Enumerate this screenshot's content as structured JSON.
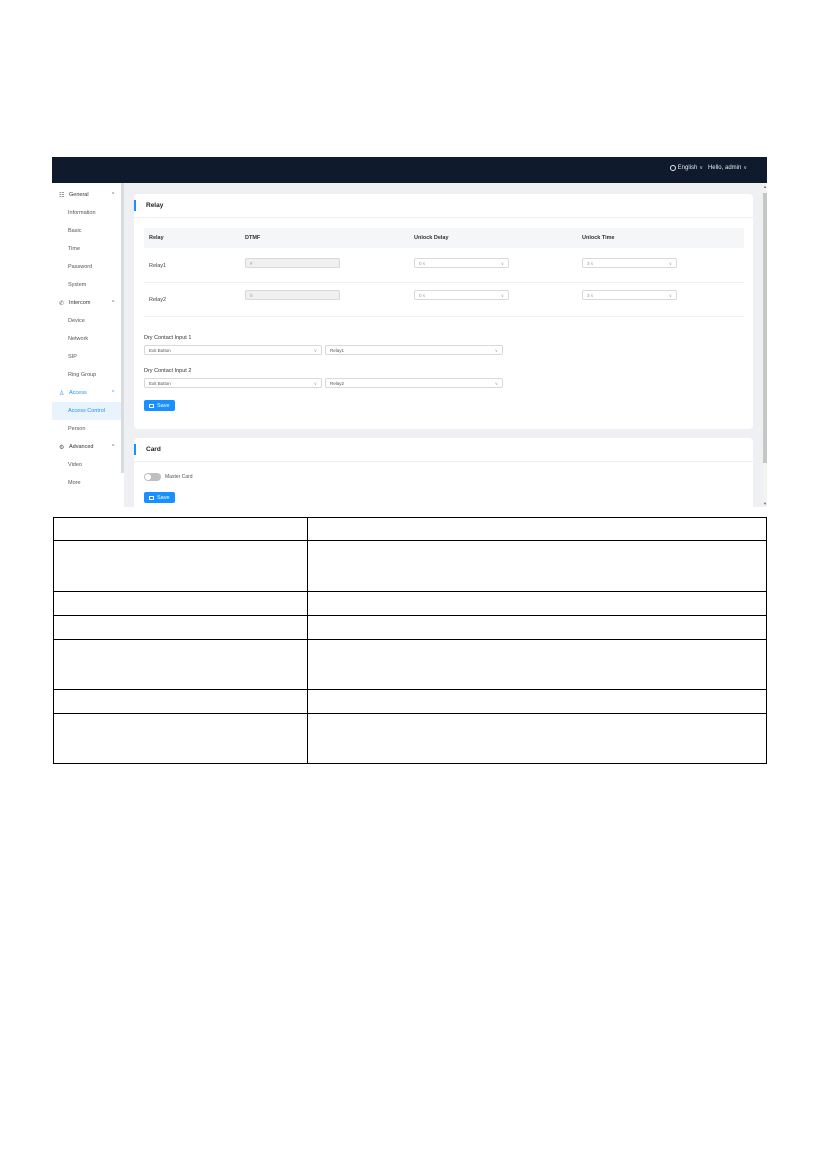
{
  "header": {
    "language": "English",
    "user": "Hello, admin"
  },
  "sidebar": {
    "groups": [
      {
        "label": "General",
        "items": [
          "Information",
          "Basic",
          "Time",
          "Password",
          "System"
        ]
      },
      {
        "label": "Intercom",
        "items": [
          "Device",
          "Network",
          "SIP",
          "Ring Group"
        ]
      },
      {
        "label": "Access",
        "items": [
          "Access Control",
          "Person"
        ]
      },
      {
        "label": "Advanced",
        "items": [
          "Video",
          "More"
        ]
      }
    ],
    "active_item": "Access Control"
  },
  "relay_panel": {
    "title": "Relay",
    "columns": [
      "Relay",
      "DTMF",
      "Unlock Delay",
      "Unlock Time"
    ],
    "rows": [
      {
        "relay": "Relay1",
        "dtmf": "#",
        "unlock_delay": "0 s",
        "unlock_time": "3 s"
      },
      {
        "relay": "Relay2",
        "dtmf": "0",
        "unlock_delay": "0 s",
        "unlock_time": "3 s"
      }
    ],
    "inputs": [
      {
        "label": "Dry Contact Input 1",
        "type": "Exit Button",
        "relay": "Relay1"
      },
      {
        "label": "Dry Contact Input 2",
        "type": "Exit Button",
        "relay": "Relay2"
      }
    ],
    "save_label": "Save"
  },
  "card_panel": {
    "title": "Card",
    "toggle_label": "Master Card",
    "save_label": "Save"
  }
}
